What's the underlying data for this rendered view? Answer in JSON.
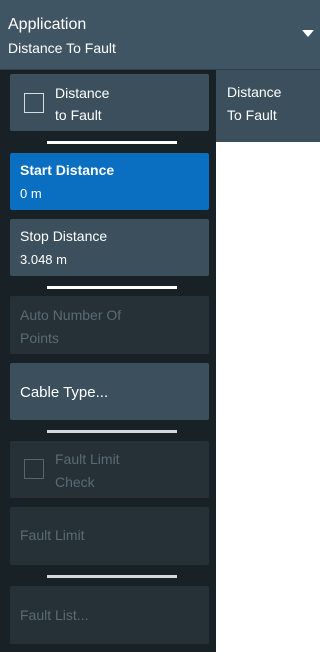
{
  "header": {
    "title": "Application",
    "subtitle": "Distance To Fault"
  },
  "side_tab": {
    "line1": "Distance",
    "line2": "To Fault"
  },
  "softkeys": {
    "dtf_toggle": {
      "line1": "Distance",
      "line2": "to Fault",
      "checked": false
    },
    "start_distance": {
      "label": "Start Distance",
      "value": "0 m"
    },
    "stop_distance": {
      "label": "Stop Distance",
      "value": "3.048 m"
    },
    "auto_points": {
      "line1": "Auto Number Of",
      "line2": "Points"
    },
    "cable_type": {
      "label": "Cable Type..."
    },
    "fault_limit_check": {
      "line1": "Fault Limit",
      "line2": "Check",
      "checked": false
    },
    "fault_limit": {
      "label": "Fault Limit"
    },
    "fault_list": {
      "label": "Fault List..."
    }
  },
  "colors": {
    "panel_bg": "#182126",
    "button_bg": "#3b4f5c",
    "active_bg": "#0a6fc1",
    "disabled_bg": "#263137",
    "disabled_text": "#5b6a73"
  }
}
